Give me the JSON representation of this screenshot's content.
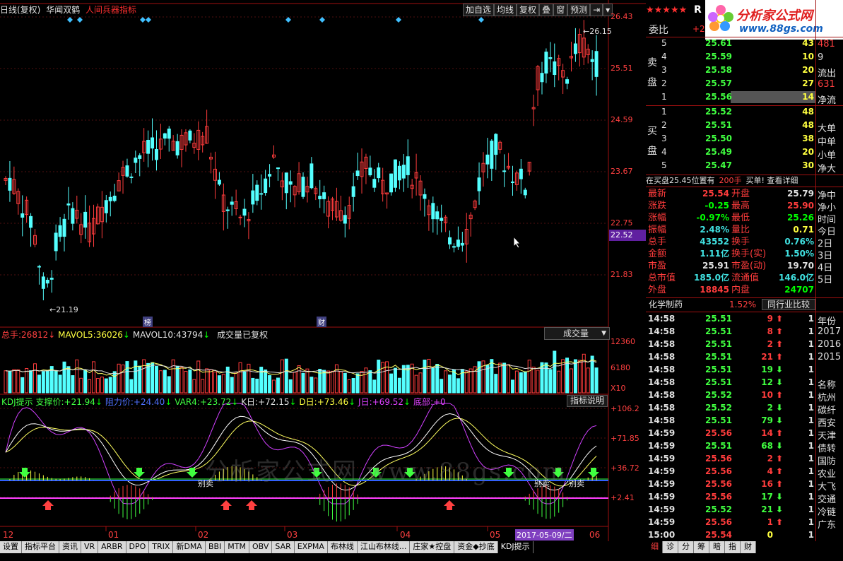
{
  "title_bar": {
    "mode": "日线(复权)",
    "stock": "华闻双鹤",
    "indicator": "人间兵器指标"
  },
  "toolbar": [
    "加自选",
    "均线",
    "复权",
    "叠",
    "窗",
    "预测",
    "⇥",
    "▾"
  ],
  "price_axis": [
    "26.43",
    "25.51",
    "24.59",
    "23.67",
    "22.75",
    "21.83"
  ],
  "current_price_tag": "22.52",
  "high_label": "26.15",
  "low_label": "21.19",
  "markers": {
    "bang": "榜",
    "cai": "财"
  },
  "volume_header": {
    "label": "总手:",
    "value": "26812",
    "ma5_label": "MAVOL5:",
    "ma5": "36026",
    "ma10_label": "MAVOL10:",
    "ma10": "43794",
    "note": "成交量已复权",
    "select": "成交量"
  },
  "volume_axis": [
    "12360",
    "6180",
    "X10"
  ],
  "kdj_header": {
    "name": "KDJ提示",
    "support_label": "支撑价:",
    "support": "+21.94",
    "resist_label": "阻力价:",
    "resist": "+24.40",
    "var4_label": "VAR4:",
    "var4": "+23.72",
    "k_label": "K日:",
    "k": "+72.15",
    "d_label": "D日:",
    "d": "+73.46",
    "j_label": "J日:",
    "j": "+69.52",
    "bottom_label": "底部:",
    "bottom": "+0",
    "help": "指标说明"
  },
  "kdj_axis": [
    "+106.2",
    "+71.85",
    "+36.72",
    "+2.41"
  ],
  "kdj_labels": [
    "别卖",
    "别卖",
    "别卖"
  ],
  "x_axis": [
    "12",
    "01",
    "02",
    "03",
    "04",
    "05",
    "06"
  ],
  "date_cursor": "2017-05-09/二",
  "watermark": "分析家公式网 www.88gs.com",
  "logo": {
    "text": "分析家公式网",
    "url": "www.88gs.com"
  },
  "side": {
    "stars": "★★★★★",
    "r": "R",
    "webi_label": "委比",
    "webi_value": "+2",
    "sell_label": "卖盘",
    "buy_label": "买盘",
    "sell": [
      {
        "n": "5",
        "p": "25.61",
        "v": "43",
        "x": "481"
      },
      {
        "n": "4",
        "p": "25.59",
        "v": "10",
        "x": "9"
      },
      {
        "n": "3",
        "p": "25.58",
        "v": "20",
        "x": "流出"
      },
      {
        "n": "2",
        "p": "25.57",
        "v": "27",
        "x": "631"
      },
      {
        "n": "1",
        "p": "25.56",
        "v": "14",
        "x": "净流"
      }
    ],
    "buy": [
      {
        "n": "1",
        "p": "25.52",
        "v": "48",
        "x": ""
      },
      {
        "n": "2",
        "p": "25.51",
        "v": "48",
        "x": "大单"
      },
      {
        "n": "3",
        "p": "25.50",
        "v": "38",
        "x": "中单"
      },
      {
        "n": "4",
        "p": "25.49",
        "v": "20",
        "x": "小单"
      },
      {
        "n": "5",
        "p": "25.47",
        "v": "30",
        "x": "净大"
      }
    ],
    "notice": "在买盘25.45位置有",
    "notice_qty": "200手",
    "notice_tail": "买单! 查看详细",
    "quote": [
      {
        "l1": "最新",
        "v1": "25.54",
        "c1": "up",
        "l2": "开盘",
        "v2": "25.79",
        "c2": "wh",
        "x": "净中"
      },
      {
        "l1": "涨跌",
        "v1": "-0.25",
        "c1": "dn",
        "l2": "最高",
        "v2": "25.90",
        "c2": "up",
        "x": "净小"
      },
      {
        "l1": "涨幅",
        "v1": "-0.97%",
        "c1": "dn",
        "l2": "最低",
        "v2": "25.26",
        "c2": "dn",
        "x": "时间"
      },
      {
        "l1": "振幅",
        "v1": "2.48%",
        "c1": "cy",
        "l2": "量比",
        "v2": "0.71",
        "c2": "yl",
        "x": "今日"
      },
      {
        "l1": "总手",
        "v1": "43552",
        "c1": "cy",
        "l2": "换手",
        "v2": "0.76%",
        "c2": "cy",
        "x": "2日"
      },
      {
        "l1": "金额",
        "v1": "1.11亿",
        "c1": "cy",
        "l2": "换手(实)",
        "v2": "1.50%",
        "c2": "cy",
        "x": "3日"
      },
      {
        "l1": "市盈",
        "v1": "25.91",
        "c1": "wh",
        "l2": "市盈(动)",
        "v2": "19.70",
        "c2": "wh",
        "x": "4日"
      },
      {
        "l1": "总市值",
        "v1": "185.0亿",
        "c1": "cy",
        "l2": "流通值",
        "v2": "146.0亿",
        "c2": "cy",
        "x": "5日"
      },
      {
        "l1": "外盘",
        "v1": "18845",
        "c1": "up",
        "l2": "内盘",
        "v2": "24707",
        "c2": "dn",
        "x": ""
      }
    ],
    "sector": {
      "name": "化学制药",
      "pct": "1.52%",
      "btn": "同行业比较"
    },
    "ticks": [
      {
        "t": "14:58",
        "p": "25.51",
        "v": "9",
        "d": "up",
        "x": "年份"
      },
      {
        "t": "14:58",
        "p": "25.51",
        "v": "8",
        "d": "up",
        "x": "2017"
      },
      {
        "t": "14:58",
        "p": "25.51",
        "v": "2",
        "d": "up",
        "x": "2016"
      },
      {
        "t": "14:58",
        "p": "25.51",
        "v": "21",
        "d": "up",
        "x": "2015"
      },
      {
        "t": "14:58",
        "p": "25.51",
        "v": "19",
        "d": "dn",
        "x": ""
      },
      {
        "t": "14:58",
        "p": "25.51",
        "v": "12",
        "d": "dn",
        "x": "名称"
      },
      {
        "t": "14:58",
        "p": "25.52",
        "v": "10",
        "d": "up",
        "x": "杭州"
      },
      {
        "t": "14:58",
        "p": "25.52",
        "v": "2",
        "d": "dn",
        "x": "碳纤"
      },
      {
        "t": "14:58",
        "p": "25.51",
        "v": "79",
        "d": "dn",
        "x": "西安"
      },
      {
        "t": "14:59",
        "p": "25.56",
        "v": "14",
        "d": "up",
        "x": "天津"
      },
      {
        "t": "14:59",
        "p": "25.51",
        "v": "68",
        "d": "dn",
        "x": "债转"
      },
      {
        "t": "14:59",
        "p": "25.56",
        "v": "2",
        "d": "up",
        "x": "国防"
      },
      {
        "t": "14:59",
        "p": "25.56",
        "v": "4",
        "d": "up",
        "x": "农业"
      },
      {
        "t": "14:59",
        "p": "25.56",
        "v": "16",
        "d": "up",
        "x": "大飞"
      },
      {
        "t": "14:59",
        "p": "25.56",
        "v": "17",
        "d": "dn",
        "x": "交通"
      },
      {
        "t": "14:59",
        "p": "25.52",
        "v": "21",
        "d": "dn",
        "x": "冷链"
      },
      {
        "t": "14:59",
        "p": "25.56",
        "v": "1",
        "d": "up",
        "x": "广东"
      },
      {
        "t": "15:00",
        "p": "25.54",
        "v": "0",
        "d": "none",
        "x": ""
      }
    ]
  },
  "bottom_tabs": [
    "设置",
    "指标平台",
    "资讯",
    "VR",
    "ARBR",
    "DPO",
    "TRIX",
    "新DMA",
    "BBI",
    "MTM",
    "OBV",
    "SAR",
    "EXPMA",
    "布林线",
    "江山布林线...",
    "庄家★控盘",
    "资金◆抄底",
    "KDJ提示"
  ],
  "right_tabs": [
    "细",
    "诊",
    "分",
    "筹",
    "暗",
    "指",
    "财"
  ],
  "colors": {
    "up": "#ff3c3c",
    "down": "#54ffff",
    "kdj_k": "#ffffff",
    "kdj_d": "#ffff60",
    "kdj_j": "#d040ff",
    "support": "#3060ff",
    "var4": "#30ff30",
    "pink": "#ff40ff"
  }
}
